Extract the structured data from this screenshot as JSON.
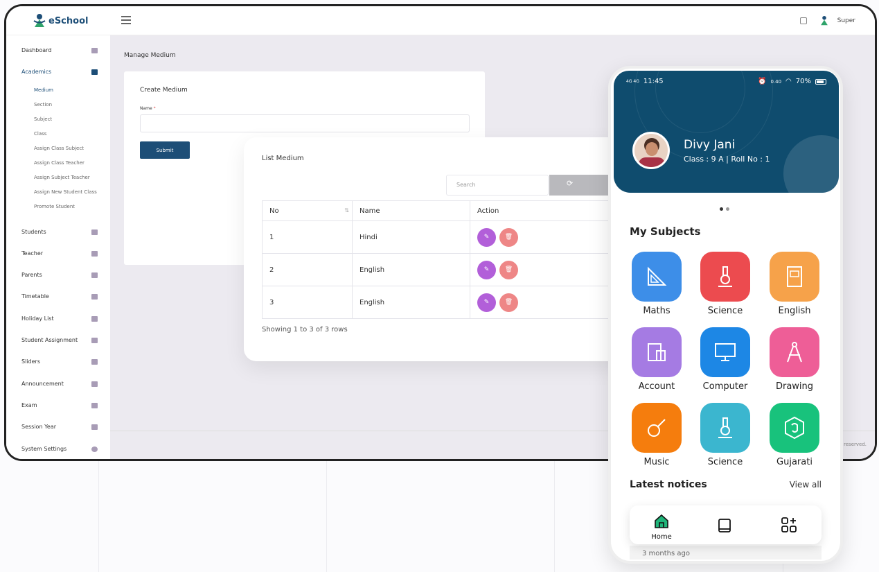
{
  "app": {
    "brand": "eSchool",
    "user": "Super"
  },
  "sidebar": {
    "items": [
      {
        "label": "Dashboard",
        "icon": "home-icon"
      },
      {
        "label": "Academics",
        "icon": "institution-icon"
      },
      {
        "label": "Students",
        "icon": "graduation-cap-icon"
      },
      {
        "label": "Teacher",
        "icon": "user-icon"
      },
      {
        "label": "Parents",
        "icon": "users-icon"
      },
      {
        "label": "Timetable",
        "icon": "calendar-icon"
      },
      {
        "label": "Holiday List",
        "icon": "calendar-check-icon"
      },
      {
        "label": "Student Assignment",
        "icon": "tasks-icon"
      },
      {
        "label": "Sliders",
        "icon": "list-icon"
      },
      {
        "label": "Announcement",
        "icon": "check-icon"
      },
      {
        "label": "Exam",
        "icon": "book-icon"
      },
      {
        "label": "Session Year",
        "icon": "calendar-icon"
      },
      {
        "label": "System Settings",
        "icon": "gear-icon"
      }
    ],
    "academics_sub": [
      "Medium",
      "Section",
      "Subject",
      "Class",
      "Assign Class Subject",
      "Assign Class Teacher",
      "Assign Subject Teacher",
      "Assign New Student Class",
      "Promote Student"
    ]
  },
  "page": {
    "title": "Manage Medium"
  },
  "create": {
    "title": "Create Medium",
    "name_label": "Name",
    "required": "*",
    "submit": "Submit"
  },
  "list": {
    "title": "List Medium",
    "search_placeholder": "Search",
    "columns": [
      "No",
      "Name",
      "Action"
    ],
    "rows": [
      {
        "no": "1",
        "name": "Hindi"
      },
      {
        "no": "2",
        "name": "English"
      },
      {
        "no": "3",
        "name": "English"
      }
    ],
    "showing": "Showing 1 to 3 of 3 rows"
  },
  "footer": {
    "text": "s reserved."
  },
  "phone": {
    "time": "11:45",
    "network_left": "4G 4G",
    "speed": "0.40",
    "battery": "70%",
    "student_name": "Divy Jani",
    "student_class": "Class : 9 A   |   Roll No : 1",
    "section_title": "My Subjects",
    "subjects": [
      {
        "name": "Maths",
        "color": "#3d8ee8"
      },
      {
        "name": "Science",
        "color": "#ec4b4f"
      },
      {
        "name": "English",
        "color": "#f6a24a"
      },
      {
        "name": "Account",
        "color": "#a57be3"
      },
      {
        "name": "Computer",
        "color": "#1d87e5"
      },
      {
        "name": "Drawing",
        "color": "#ee5e97"
      },
      {
        "name": "Music",
        "color": "#f57d0d"
      },
      {
        "name": "Science",
        "color": "#3bb6cf"
      },
      {
        "name": "Gujarati",
        "color": "#18c27c"
      }
    ],
    "notices_title": "Latest notices",
    "view_all": "View all",
    "notice_age": "3 months ago",
    "nav": {
      "home": "Home"
    }
  },
  "colors": {
    "primary": "#1d4e77",
    "header": "#0f4c6e",
    "edit": "#b25fd9",
    "delete": "#ee8686"
  }
}
